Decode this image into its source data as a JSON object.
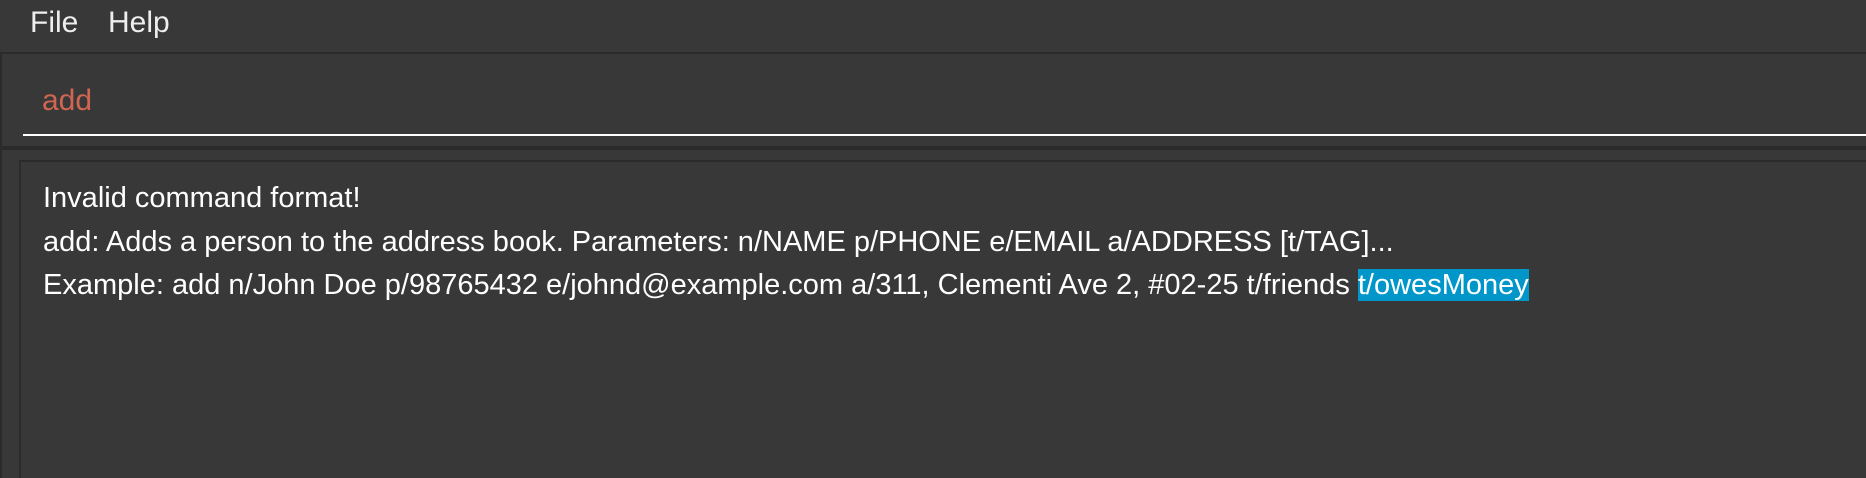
{
  "menu": {
    "file": "File",
    "help": "Help"
  },
  "command_box": {
    "value": "add",
    "text_color": "#d06651"
  },
  "result": {
    "line1": "Invalid command format!",
    "line2": "add: Adds a person to the address book. Parameters: n/NAME p/PHONE e/EMAIL a/ADDRESS [t/TAG]...",
    "line3_prefix": "Example: add n/John Doe p/98765432 e/johnd@example.com a/311, Clementi Ave 2, #02-25 t/friends ",
    "line3_selected": "t/owesMoney",
    "selection_color": "#0096c9"
  }
}
